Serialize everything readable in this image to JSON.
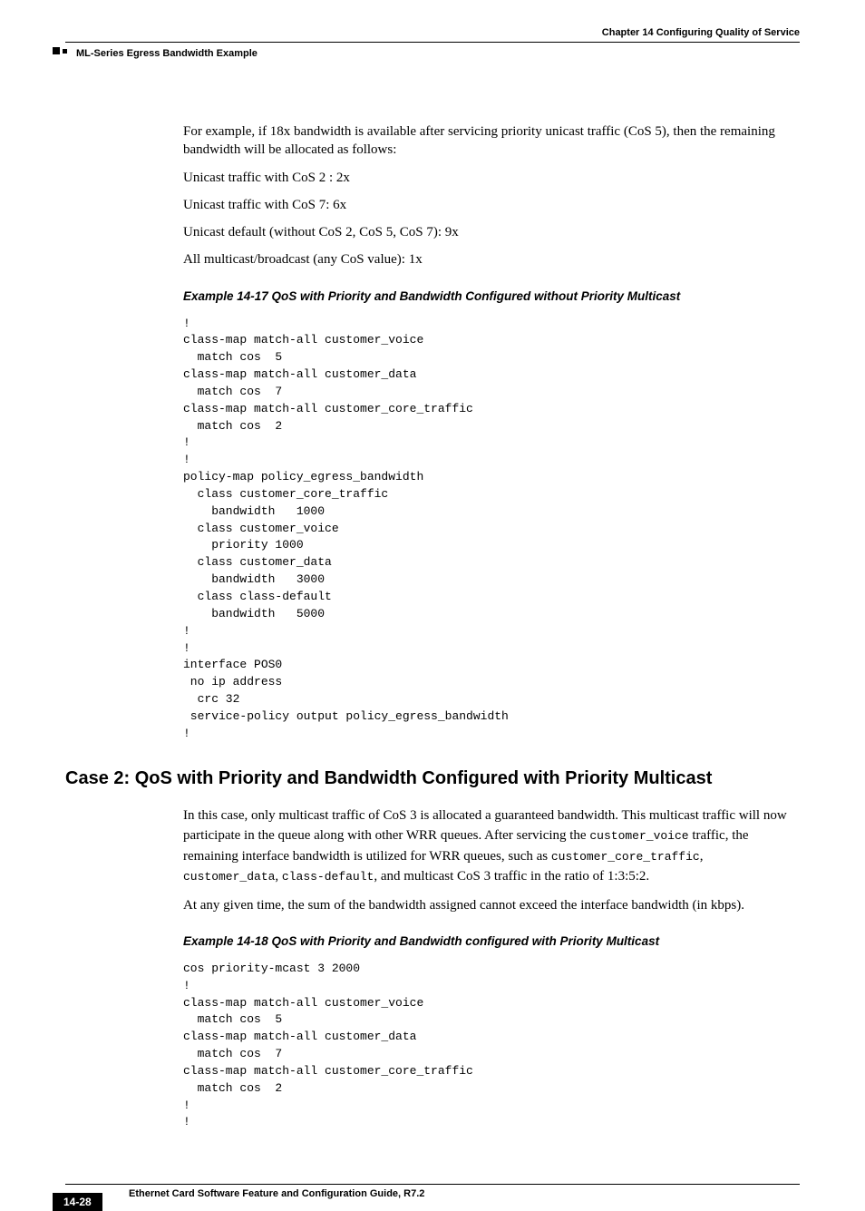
{
  "header": {
    "chapter": "Chapter 14 Configuring Quality of Service",
    "section": "ML-Series Egress Bandwidth Example"
  },
  "intro": {
    "p1": "For example, if 18x bandwidth is available after servicing priority unicast traffic (CoS 5), then the remaining bandwidth will be allocated as follows:",
    "b1": "Unicast traffic with CoS 2 : 2x",
    "b2": "Unicast traffic with CoS 7: 6x",
    "b3": "Unicast default (without CoS 2, CoS 5, CoS 7): 9x",
    "b4": "All multicast/broadcast (any CoS value): 1x"
  },
  "example17": {
    "title": "Example 14-17 QoS with Priority and Bandwidth Configured without Priority Multicast",
    "code": "!\nclass-map match-all customer_voice\n  match cos  5\nclass-map match-all customer_data\n  match cos  7\nclass-map match-all customer_core_traffic\n  match cos  2\n!\n!\npolicy-map policy_egress_bandwidth\n  class customer_core_traffic\n    bandwidth   1000\n  class customer_voice\n    priority 1000\n  class customer_data\n    bandwidth   3000\n  class class-default\n    bandwidth   5000\n!\n!\ninterface POS0\n no ip address\n  crc 32\n service-policy output policy_egress_bandwidth\n!"
  },
  "case2": {
    "heading": "Case 2: QoS with Priority and Bandwidth Configured with Priority Multicast",
    "p1a": "In this case, only multicast traffic of CoS 3 is allocated a guaranteed bandwidth. This multicast traffic will now participate in the queue along with other WRR queues. After servicing the ",
    "p1b": "customer_voice",
    "p1c": " traffic, the remaining interface bandwidth is utilized for WRR queues, such as ",
    "p1d": "customer_core_traffic",
    "p1e": ", ",
    "p1f": "customer_data",
    "p1g": ", ",
    "p1h": "class-default",
    "p1i": ", and multicast CoS 3 traffic in the ratio of 1:3:5:2.",
    "p2": "At any given time, the sum of the bandwidth assigned cannot exceed the interface bandwidth (in kbps)."
  },
  "example18": {
    "title": "Example 14-18 QoS with Priority and Bandwidth configured with Priority Multicast",
    "code": "cos priority-mcast 3 2000\n!\nclass-map match-all customer_voice\n  match cos  5\nclass-map match-all customer_data\n  match cos  7\nclass-map match-all customer_core_traffic\n  match cos  2\n!\n!"
  },
  "footer": {
    "doc_title": "Ethernet Card Software Feature and Configuration Guide, R7.2",
    "page": "14-28"
  }
}
